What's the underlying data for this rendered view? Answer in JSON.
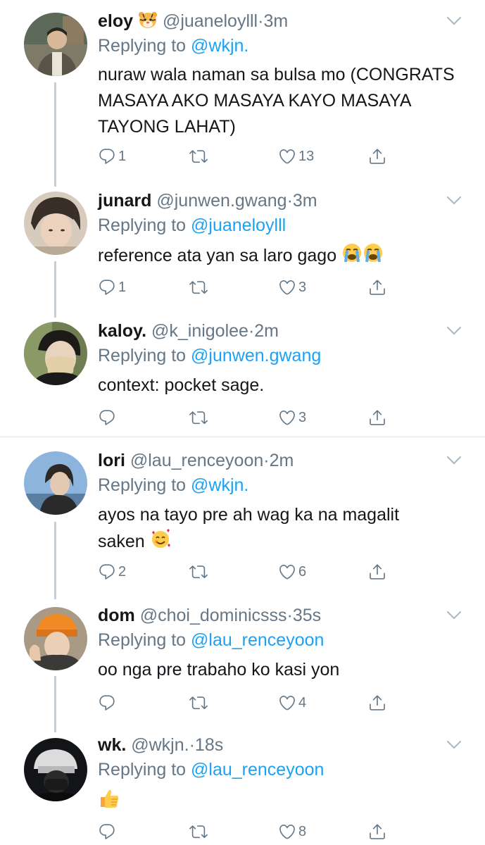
{
  "tweets": [
    {
      "name": "eloy",
      "handle": "@juaneloylll",
      "dot": "·",
      "time": "3m",
      "reply_prefix": "Replying to",
      "reply_to": "@wkjn.",
      "text": "nuraw wala naman sa bulsa mo (CONGRATS MASAYA AKO MASAYA KAYO MASAYA TAYONG LAHAT)",
      "replies": "1",
      "retweets": "",
      "likes": "13"
    },
    {
      "name": "junard",
      "handle": "@junwen.gwang",
      "dot": "·",
      "time": "3m",
      "reply_prefix": "Replying to",
      "reply_to": "@juaneloylll",
      "text": "reference ata yan sa laro gago",
      "replies": "1",
      "retweets": "",
      "likes": "3"
    },
    {
      "name": "kaloy.",
      "handle": "@k_inigolee",
      "dot": "·",
      "time": "2m",
      "reply_prefix": "Replying to",
      "reply_to": "@junwen.gwang",
      "text": "context: pocket sage.",
      "replies": "",
      "retweets": "",
      "likes": "3"
    },
    {
      "name": "lori",
      "handle": "@lau_renceyoon",
      "dot": "·",
      "time": "2m",
      "reply_prefix": "Replying to",
      "reply_to": "@wkjn.",
      "text": "ayos na tayo pre ah wag ka na magalit saken",
      "replies": "2",
      "retweets": "",
      "likes": "6"
    },
    {
      "name": "dom",
      "handle": "@choi_dominicsss",
      "dot": "·",
      "time": "35s",
      "reply_prefix": "Replying to",
      "reply_to": "@lau_renceyoon",
      "text": "oo nga pre trabaho ko kasi yon",
      "replies": "",
      "retweets": "",
      "likes": "4"
    },
    {
      "name": "wk.",
      "handle": "@wkjn.",
      "dot": "·",
      "time": "18s",
      "reply_prefix": "Replying to",
      "reply_to": "@lau_renceyoon",
      "text": "",
      "replies": "",
      "retweets": "",
      "likes": "8"
    }
  ],
  "icons": {
    "name_badge": "tiger-face-emoji",
    "reply": "reply-bubble-icon",
    "retweet": "retweet-icon",
    "like": "heart-icon",
    "share": "share-icon",
    "menu": "chevron-down-icon"
  },
  "colors": {
    "link": "#1da1f2",
    "muted": "#657786",
    "thread": "#c4cfd6",
    "divider": "#e1e8ed"
  }
}
